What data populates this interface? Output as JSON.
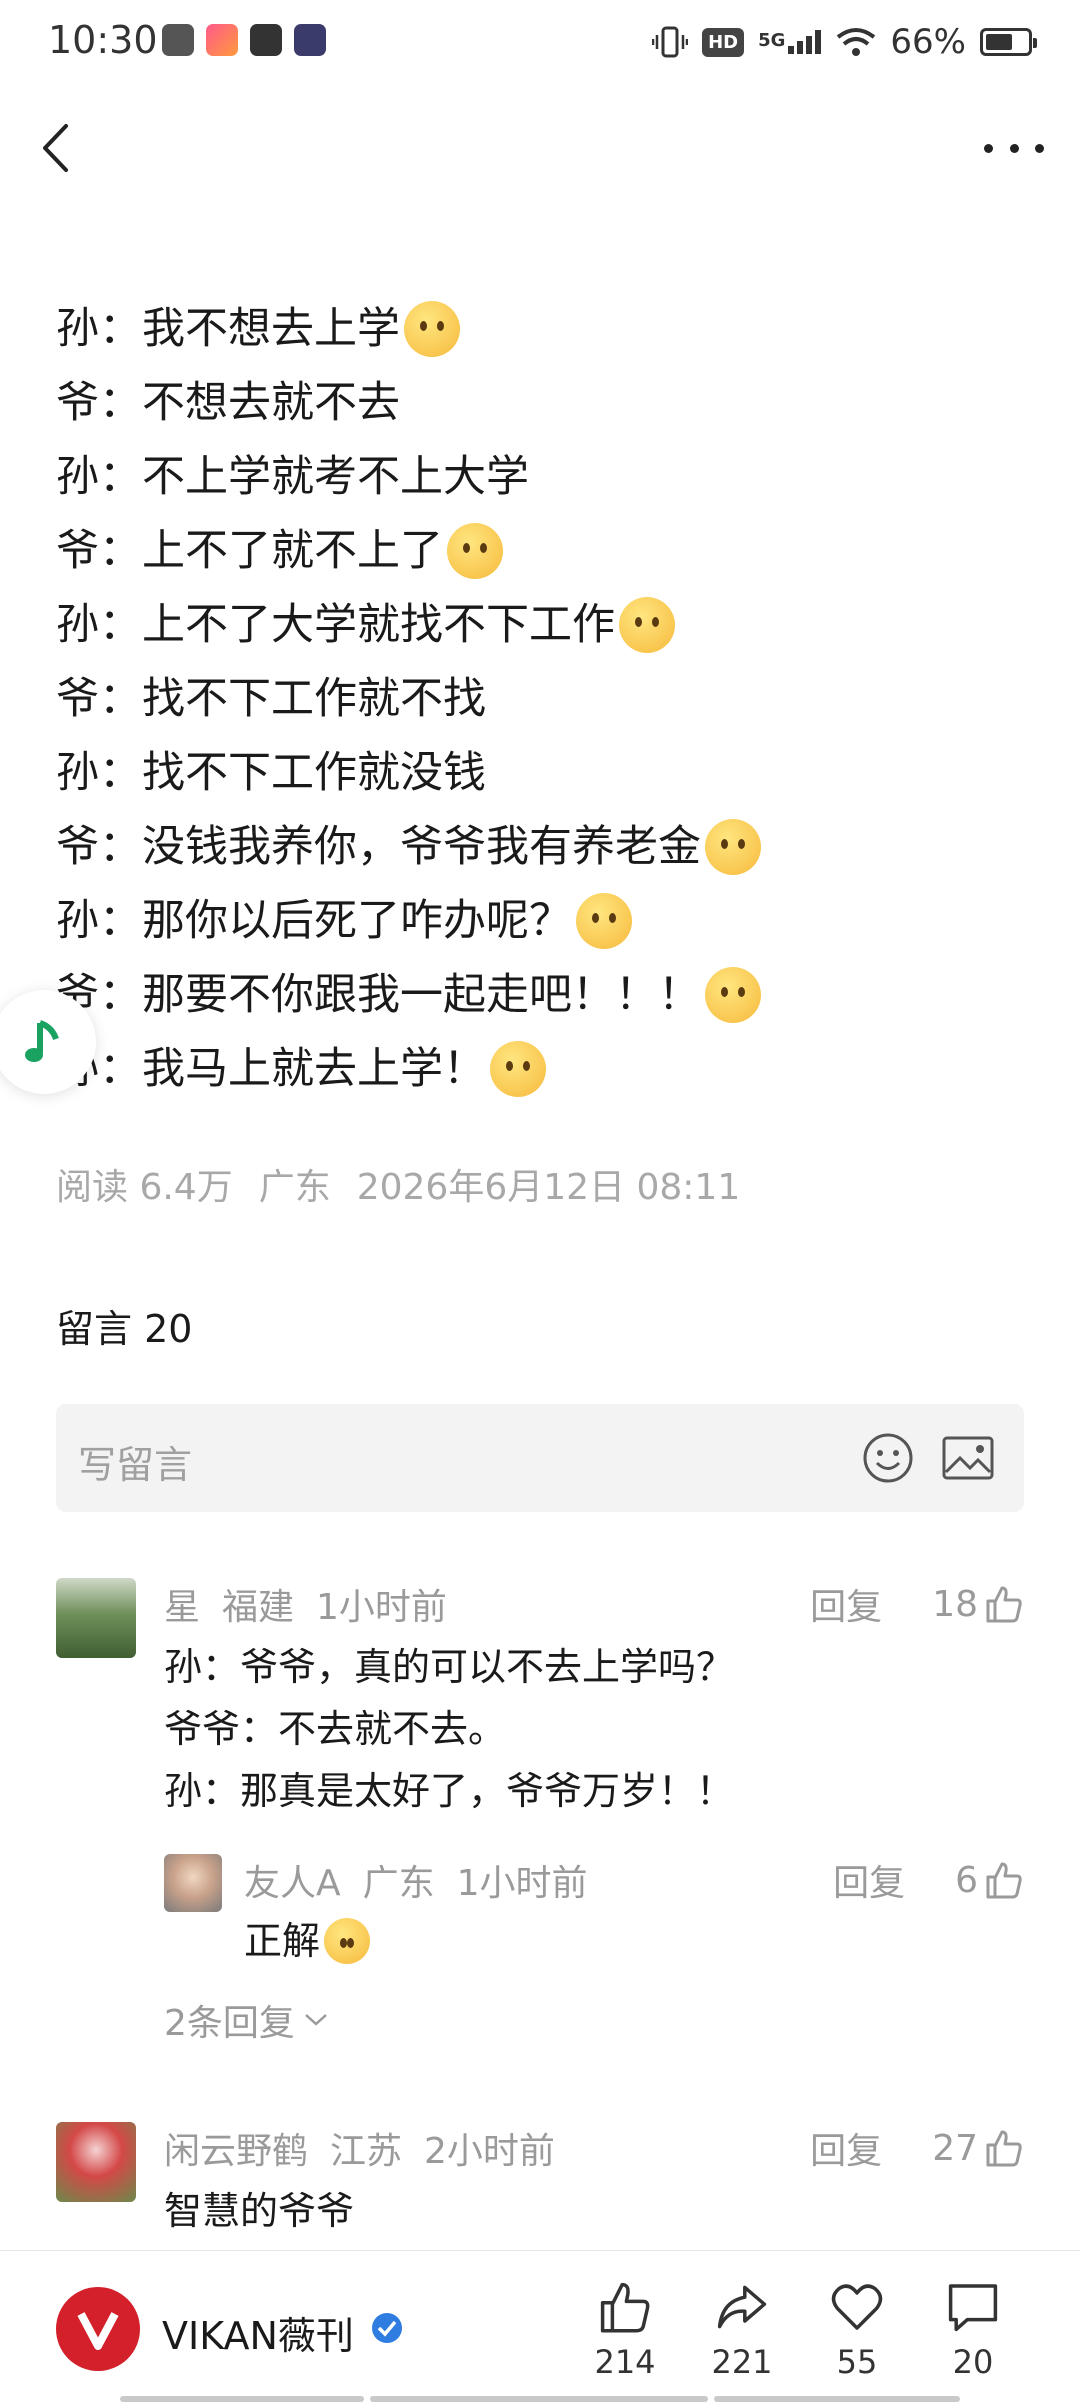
{
  "status_bar": {
    "time": "10:30",
    "hd": "HD",
    "network": "5G",
    "battery_percent": "66%",
    "battery_level": 0.66
  },
  "article": {
    "lines": [
      {
        "speaker": "孙",
        "sep": "：",
        "text": "我不想去上学",
        "emoji": "pleading-face-emoji"
      },
      {
        "speaker": "爷",
        "sep": "：",
        "text": "不想去就不去"
      },
      {
        "speaker": "孙",
        "sep": "：",
        "text": "不上学就考不上大学"
      },
      {
        "speaker": "爷",
        "sep": "：",
        "text": "上不了就不上了",
        "emoji": "hand-over-mouth-emoji"
      },
      {
        "speaker": "孙",
        "sep": "：",
        "text": "上不了大学就找不下工作",
        "emoji": "worried-face-emoji"
      },
      {
        "speaker": "爷",
        "sep": "：",
        "text": "找不下工作就不找"
      },
      {
        "speaker": "孙",
        "sep": "：",
        "text": "找不下工作就没钱"
      },
      {
        "speaker": "爷",
        "sep": "：",
        "text": "没钱我养你，爷爷我有养老金",
        "emoji": "monocle-face-emoji"
      },
      {
        "speaker": "孙",
        "sep": "：",
        "text": "那你以后死了咋办呢？",
        "emoji": "flushed-face-emoji"
      },
      {
        "speaker": "爷",
        "sep": "：",
        "text": "那要不你跟我一起走吧！！！",
        "emoji": "nauseated-face-emoji"
      },
      {
        "speaker": "孙",
        "sep": "：",
        "text": "我马上就去上学！",
        "emoji": "confused-face-emoji"
      }
    ],
    "meta": {
      "reads": "阅读 6.4万",
      "location": "广东",
      "datetime": "2026年6月12日 08:11"
    }
  },
  "comments_section": {
    "title": "留言 20",
    "input_placeholder": "写留言"
  },
  "comments": [
    {
      "user": "星",
      "location": "福建",
      "time": "1小时前",
      "reply_label": "回复",
      "likes": "18",
      "body": [
        "孙：爷爷，真的可以不去上学吗？",
        "爷爷：不去就不去。",
        "孙：那真是太好了，爷爷万岁！！"
      ],
      "replies": [
        {
          "user": "友人A",
          "location": "广东",
          "time": "1小时前",
          "reply_label": "回复",
          "likes": "6",
          "body": "正解"
        }
      ],
      "more_replies": "2条回复"
    },
    {
      "user": "闲云野鹤",
      "location": "江苏",
      "time": "2小时前",
      "reply_label": "回复",
      "likes": "27",
      "body": [
        "智慧的爷爷"
      ]
    }
  ],
  "bottom_bar": {
    "account_name": "VIKAN薇刊",
    "like_count": "214",
    "share_count": "221",
    "favorite_count": "55",
    "comment_count": "20"
  },
  "colors": {
    "brand_red": "#d3202a",
    "verified_blue": "#2f7de1",
    "music_green": "#1aa260"
  }
}
